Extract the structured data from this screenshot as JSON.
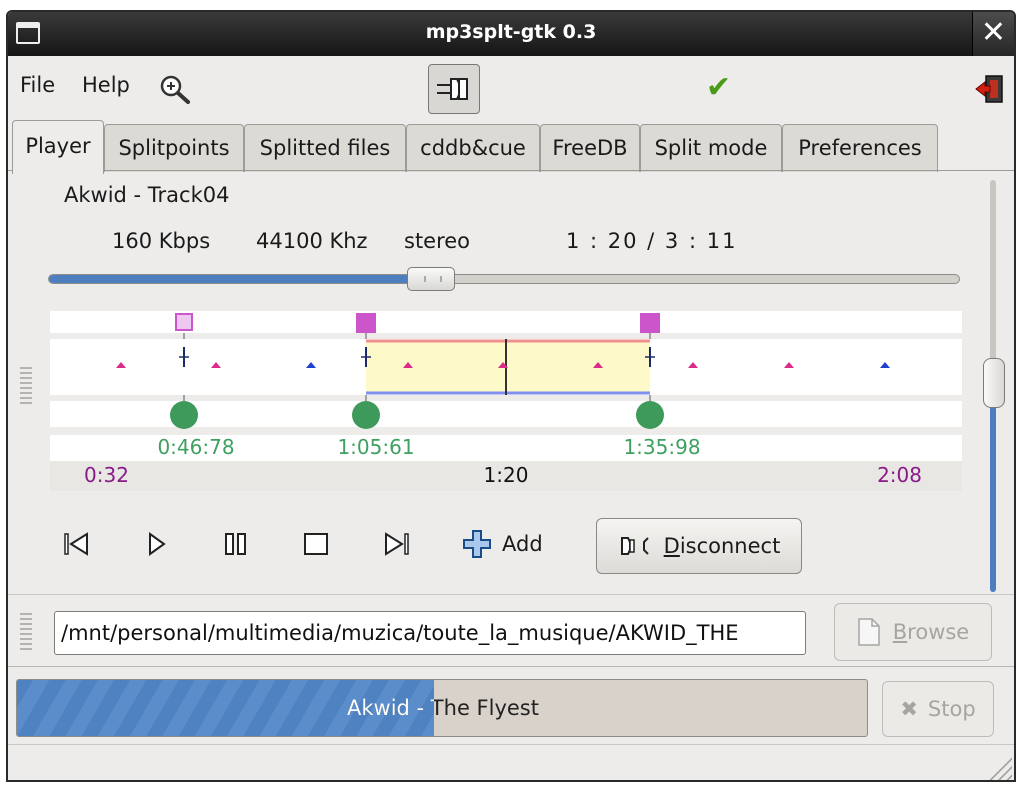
{
  "window": {
    "title": "mp3splt-gtk 0.3"
  },
  "menu": {
    "file": "File",
    "help": "Help"
  },
  "tabs": [
    {
      "label": "Player",
      "active": true
    },
    {
      "label": "Splitpoints"
    },
    {
      "label": "Splitted files"
    },
    {
      "label": "cddb&cue"
    },
    {
      "label": "FreeDB"
    },
    {
      "label": "Split mode"
    },
    {
      "label": "Preferences"
    }
  ],
  "player": {
    "song_name": "Akwid - Track04",
    "bitrate": "160 Kbps",
    "frequency": "44100 Khz",
    "channels": "stereo",
    "time_label": "1 : 20 / 3 : 11",
    "progress_fraction": 0.42
  },
  "splitview": {
    "view_start": "0:32",
    "view_center": "1:20",
    "view_end": "2:08",
    "splitpoints": [
      {
        "label": "0:46:78",
        "checked": false
      },
      {
        "label": "1:05:61",
        "checked": true
      },
      {
        "label": "1:35:98",
        "checked": true
      }
    ]
  },
  "controls": {
    "add_label": "Add",
    "disconnect_label": "Disconnect",
    "disconnect_mnemonic": "D",
    "disconnect_rest": "isconnect"
  },
  "file": {
    "path": "/mnt/personal/multimedia/muzica/toute_la_musique/AKWID_THE",
    "browse_mnemonic": "B",
    "browse_rest": "rowse"
  },
  "status": {
    "progress_text": "Akwid - The Flyest",
    "progress_fraction": 0.49,
    "stop_label": "Stop"
  },
  "colors": {
    "accent": "#4d7fbf",
    "splitpoint_green": "#3e9a5a",
    "splitpoint_label": "#3fa060",
    "view_edge_label": "#8a1a8a",
    "splitpoint_marker": "#cc55cc",
    "minute_tick": "#dd2a8a",
    "hour_tick": "#2040d0",
    "selection_fill": "#fdf9c8",
    "selection_top": "#f09090",
    "selection_bottom": "#8090f0"
  }
}
